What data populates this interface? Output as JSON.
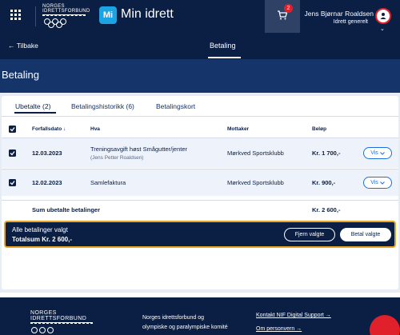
{
  "topbar": {
    "logo_line1": "NORGES",
    "logo_line2": "IDRETTSFORBUND",
    "app_badge": "Mi",
    "app_name": "Min idrett",
    "cart_count": "2",
    "user_name": "Jens Bjørnar Roaldsen",
    "user_role": "Idrett generelt"
  },
  "subnav": {
    "back_label": "← Tilbake",
    "title": "Betaling"
  },
  "page": {
    "heading": "Betaling"
  },
  "tabs": [
    {
      "label": "Ubetalte (2)",
      "active": true
    },
    {
      "label": "Betalingshistorikk (6)",
      "active": false
    },
    {
      "label": "Betalingskort",
      "active": false
    }
  ],
  "table": {
    "headers": {
      "due_date": "Forfallsdato ↓",
      "what": "Hva",
      "recipient": "Mottaker",
      "amount": "Beløp"
    },
    "rows": [
      {
        "date": "12.03.2023",
        "what": "Treningsavgift høst Smågutter/jenter",
        "what_sub": "(Jens Petter Roaldsen)",
        "recipient": "Mørkved Sportsklubb",
        "amount": "Kr. 1 700,-",
        "action": "Vis"
      },
      {
        "date": "12.02.2023",
        "what": "Samlefaktura",
        "what_sub": "",
        "recipient": "Mørkved Sportsklubb",
        "amount": "Kr. 900,-",
        "action": "Vis"
      }
    ],
    "sum_label": "Sum ubetalte betalinger",
    "sum_amount": "Kr. 2 600,-"
  },
  "paybar": {
    "line1": "Alle betalinger valgt",
    "line2": "Totalsum Kr. 2 600,-",
    "deselect_label": "Fjern valgte",
    "pay_label": "Betal valgte",
    "border_color": "#e8a422"
  },
  "footer": {
    "logo_line1": "NORGES",
    "logo_line2": "IDRETTSFORBUND",
    "text_line1": "Norges idrettsforbund og",
    "text_line2": "olympiske og paralympiske komité",
    "link_support": "Kontakt NIF Digital Support →",
    "link_privacy": "Om personvern →"
  },
  "colors": {
    "navy": "#0b1f44",
    "hero_blue": "#15356a",
    "accent_red": "#e0212b",
    "link_blue": "#1e6fd9",
    "brand_cyan": "#1ba4e4"
  }
}
